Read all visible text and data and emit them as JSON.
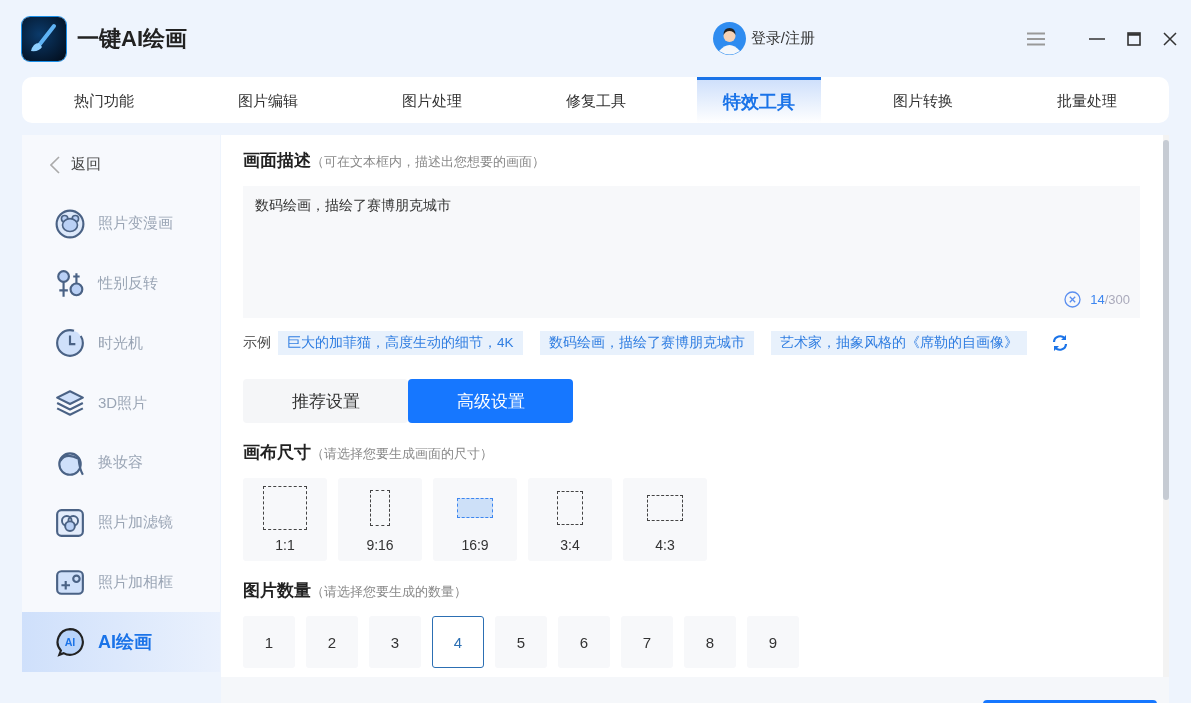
{
  "app": {
    "title": "一键AI绘画"
  },
  "user": {
    "login": "登录/注册"
  },
  "tabs": [
    {
      "label": "热门功能",
      "selected": false
    },
    {
      "label": "图片编辑",
      "selected": false
    },
    {
      "label": "图片处理",
      "selected": false
    },
    {
      "label": "修复工具",
      "selected": false
    },
    {
      "label": "特效工具",
      "selected": true
    },
    {
      "label": "图片转换",
      "selected": false
    },
    {
      "label": "批量处理",
      "selected": false
    }
  ],
  "sidebar": {
    "back": "返回",
    "items": [
      {
        "label": "照片变漫画",
        "selected": false
      },
      {
        "label": "性别反转",
        "selected": false
      },
      {
        "label": "时光机",
        "selected": false
      },
      {
        "label": "3D照片",
        "selected": false
      },
      {
        "label": "换妆容",
        "selected": false
      },
      {
        "label": "照片加滤镜",
        "selected": false
      },
      {
        "label": "照片加相框",
        "selected": false
      },
      {
        "label": "AI绘画",
        "selected": true,
        "icon_text": "AI"
      }
    ]
  },
  "description": {
    "title": "画面描述",
    "hint": "（可在文本框内，描述出您想要的画面）",
    "value": "数码绘画，描绘了赛博朋克城市",
    "count": "14",
    "limit": "/300"
  },
  "examples": {
    "label": "示例",
    "items": [
      "巨大的加菲猫，高度生动的细节，4K",
      "数码绘画，描绘了赛博朋克城市",
      "艺术家，抽象风格的《席勒的自画像》"
    ]
  },
  "modes": [
    {
      "label": "推荐设置",
      "selected": false
    },
    {
      "label": "高级设置",
      "selected": true
    }
  ],
  "canvas_size": {
    "title": "画布尺寸",
    "hint": "（请选择您要生成画面的尺寸）",
    "options": [
      {
        "label": "1:1",
        "selected": false
      },
      {
        "label": "9:16",
        "selected": false
      },
      {
        "label": "16:9",
        "selected": true
      },
      {
        "label": "3:4",
        "selected": false
      },
      {
        "label": "4:3",
        "selected": false
      }
    ]
  },
  "image_count": {
    "title": "图片数量",
    "hint": "（请选择您要生成的数量）",
    "options": [
      {
        "label": "1",
        "selected": false
      },
      {
        "label": "2",
        "selected": false
      },
      {
        "label": "3",
        "selected": false
      },
      {
        "label": "4",
        "selected": true
      },
      {
        "label": "5",
        "selected": false
      },
      {
        "label": "6",
        "selected": false
      },
      {
        "label": "7",
        "selected": false
      },
      {
        "label": "8",
        "selected": false
      },
      {
        "label": "9",
        "selected": false
      }
    ]
  }
}
